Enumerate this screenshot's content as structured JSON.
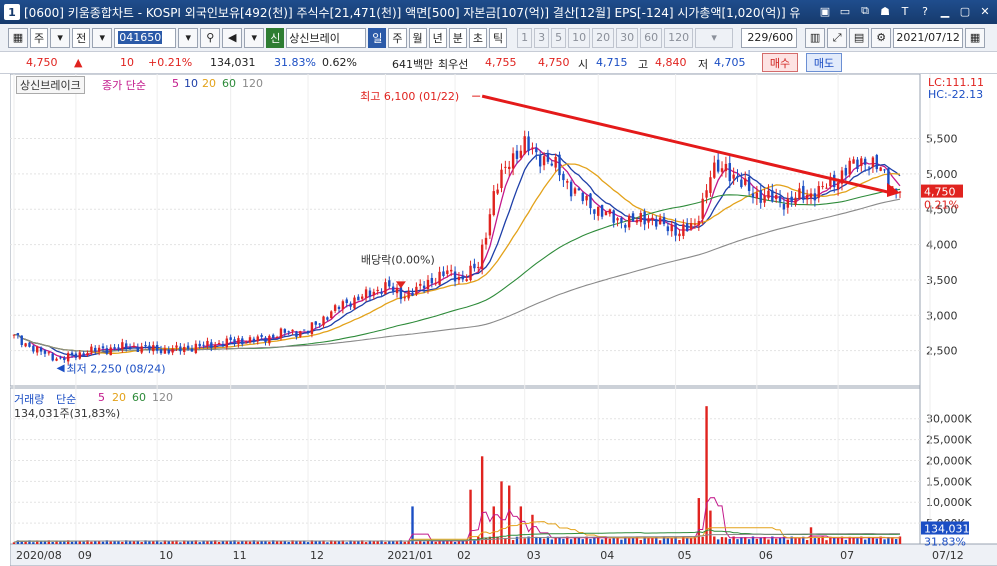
{
  "window": {
    "badge": "1",
    "title": "[0600] 키움종합차트 - KOSPI 외국인보유[492(천)] 주식수[21,471(천)] 액면[500] 자본금[107(억)] 결산[12월] EPS[-124] 시가총액[1,020(억)] 유",
    "buttons": [
      "▣",
      "▭",
      "⧉",
      "☗",
      "T",
      "?",
      "▁",
      "▢",
      "✕"
    ]
  },
  "toolbar": {
    "period_unit": "주",
    "prev_label": "전",
    "stock_code": "041650",
    "stock_flag": "신",
    "stock_name": "상신브레이",
    "interval_tabs": [
      "일",
      "주",
      "월",
      "년",
      "분",
      "초",
      "틱"
    ],
    "interval_selected": "일",
    "minute_options": [
      "1",
      "3",
      "5",
      "10",
      "20",
      "30",
      "60",
      "120"
    ],
    "page_count": "229/600",
    "date": "2021/07/12"
  },
  "quote": {
    "price": "4,750",
    "change_arrow": "▲",
    "change": "10",
    "change_pct": "+0.21%",
    "volume": "134,031",
    "volume_ratio": "31.83%",
    "turnover": "0.62%",
    "amount": "641백만",
    "best_label": "최우선",
    "best_ask": "4,755",
    "best_bid": "4,750",
    "open_label": "시",
    "open": "4,715",
    "high_label": "고",
    "high": "4,840",
    "low_label": "저",
    "low": "4,705",
    "buy_label": "매수",
    "sell_label": "매도"
  },
  "colors": {
    "up": "#e0231f",
    "down": "#1b4ec4",
    "ma5": "#c2188b",
    "ma10": "#1e3fa8",
    "ma20": "#e3a21a",
    "ma60": "#2e8b3a",
    "ma120": "#8a8a8a",
    "trendline": "#e41a1a"
  },
  "chart_data": [
    {
      "type": "candlestick",
      "legend": {
        "name": "상신브레이크",
        "series": "종가 단순",
        "periods": [
          "5",
          "10",
          "20",
          "60",
          "120"
        ]
      },
      "ylim": [
        2000,
        6300
      ],
      "y_ticks": [
        2500,
        3000,
        3500,
        4000,
        4500,
        5000,
        5500
      ],
      "y_tick_labels": [
        "2,500",
        "3,000",
        "3,500",
        "4,000",
        "4,500",
        "5,000",
        "5,500"
      ],
      "grid": true,
      "last_price_label": "4,750",
      "last_pct_label": "0.21%",
      "lc_label": "LC:111.11",
      "hc_label": "HC:-22.13",
      "annotations": {
        "high_label": "최고 6,100 (01/22)",
        "low_label": "최저 2,250 (08/24)",
        "dividend_label": "배당락(0.00%)"
      },
      "close_anchors": [
        [
          0,
          2700
        ],
        [
          6,
          2500
        ],
        [
          12,
          2380
        ],
        [
          20,
          2500
        ],
        [
          30,
          2560
        ],
        [
          40,
          2500
        ],
        [
          50,
          2580
        ],
        [
          58,
          2640
        ],
        [
          64,
          2660
        ],
        [
          70,
          2760
        ],
        [
          76,
          2780
        ],
        [
          82,
          3050
        ],
        [
          86,
          3180
        ],
        [
          92,
          3300
        ],
        [
          96,
          3420
        ],
        [
          100,
          3280
        ],
        [
          104,
          3350
        ],
        [
          108,
          3500
        ],
        [
          112,
          3600
        ],
        [
          116,
          3520
        ],
        [
          120,
          3700
        ],
        [
          124,
          4700
        ],
        [
          128,
          5200
        ],
        [
          132,
          5400
        ],
        [
          136,
          5250
        ],
        [
          140,
          5100
        ],
        [
          144,
          4800
        ],
        [
          148,
          4600
        ],
        [
          152,
          4450
        ],
        [
          156,
          4350
        ],
        [
          160,
          4320
        ],
        [
          164,
          4400
        ],
        [
          168,
          4250
        ],
        [
          172,
          4200
        ],
        [
          176,
          4250
        ],
        [
          180,
          5000
        ],
        [
          184,
          5100
        ],
        [
          188,
          4850
        ],
        [
          192,
          4700
        ],
        [
          196,
          4650
        ],
        [
          200,
          4600
        ],
        [
          204,
          4700
        ],
        [
          208,
          4750
        ],
        [
          212,
          4900
        ],
        [
          216,
          5100
        ],
        [
          220,
          5200
        ],
        [
          224,
          5050
        ],
        [
          228,
          4750
        ]
      ],
      "trendline": {
        "from": [
          121,
          6100
        ],
        "to": [
          229,
          4730
        ]
      },
      "date_labels": [
        "2020/08",
        "09",
        "10",
        "11",
        "12",
        "2021/01",
        "02",
        "03",
        "04",
        "05",
        "06",
        "07",
        "07/12"
      ]
    },
    {
      "type": "bar",
      "legend": {
        "name": "거래량",
        "series": "단순",
        "periods": [
          "5",
          "20",
          "60",
          "120"
        ],
        "current": "134,031주(31,83%)"
      },
      "ylim": [
        0,
        34000
      ],
      "y_ticks": [
        5000,
        10000,
        15000,
        20000,
        25000,
        30000
      ],
      "y_tick_labels": [
        "5,000K",
        "10,000K",
        "15,000K",
        "20,000K",
        "25,000K",
        "30,000K"
      ],
      "last_volume_label": "134,031",
      "last_pct_label": "31.83%",
      "spikes": [
        [
          103,
          9000
        ],
        [
          118,
          13000
        ],
        [
          121,
          21000
        ],
        [
          124,
          9000
        ],
        [
          126,
          15000
        ],
        [
          128,
          14000
        ],
        [
          131,
          9000
        ],
        [
          134,
          7000
        ],
        [
          177,
          11000
        ],
        [
          179,
          33000
        ],
        [
          180,
          8000
        ],
        [
          206,
          4000
        ]
      ]
    }
  ]
}
